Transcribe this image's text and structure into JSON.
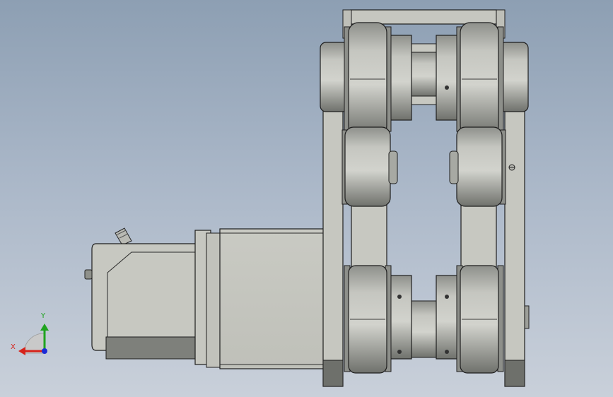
{
  "view": {
    "background_top": "#8d9fb3",
    "background_bottom": "#c9d0da",
    "part_color": "#c8c9c2",
    "part_dark": "#7b7d78",
    "edge_color": "#1e1e1e"
  },
  "triad": {
    "x_label": "X",
    "y_label": "Y",
    "x_color": "#d6231b",
    "y_color": "#1fa31f",
    "z_color": "#1c2bd6"
  },
  "model": {
    "parts": [
      "servo-motor",
      "motor-flange",
      "side-frame-plate",
      "top-bracket",
      "belt-pulley",
      "idler-roller",
      "bearing-housing",
      "timing-belt"
    ]
  }
}
